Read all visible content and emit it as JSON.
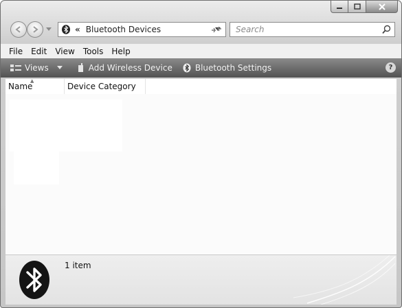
{
  "window": {
    "controls": {
      "minimize_icon": "minimize-icon",
      "maximize_icon": "maximize-icon",
      "close_icon": "close-icon"
    }
  },
  "address_bar": {
    "chevron": "«",
    "location": "Bluetooth Devices"
  },
  "search": {
    "placeholder": "Search"
  },
  "menu": {
    "file": "File",
    "edit": "Edit",
    "view": "View",
    "tools": "Tools",
    "help": "Help"
  },
  "toolbar": {
    "views": "Views",
    "add_wireless_device": "Add Wireless Device",
    "bluetooth_settings": "Bluetooth Settings",
    "help_glyph": "?"
  },
  "columns": {
    "name": "Name",
    "device_category": "Device Category"
  },
  "details": {
    "item_count": "1 item"
  },
  "colors": {
    "toolbar_top": "#8a8a8a",
    "toolbar_bottom": "#525252",
    "frame": "#cfcfcf"
  }
}
